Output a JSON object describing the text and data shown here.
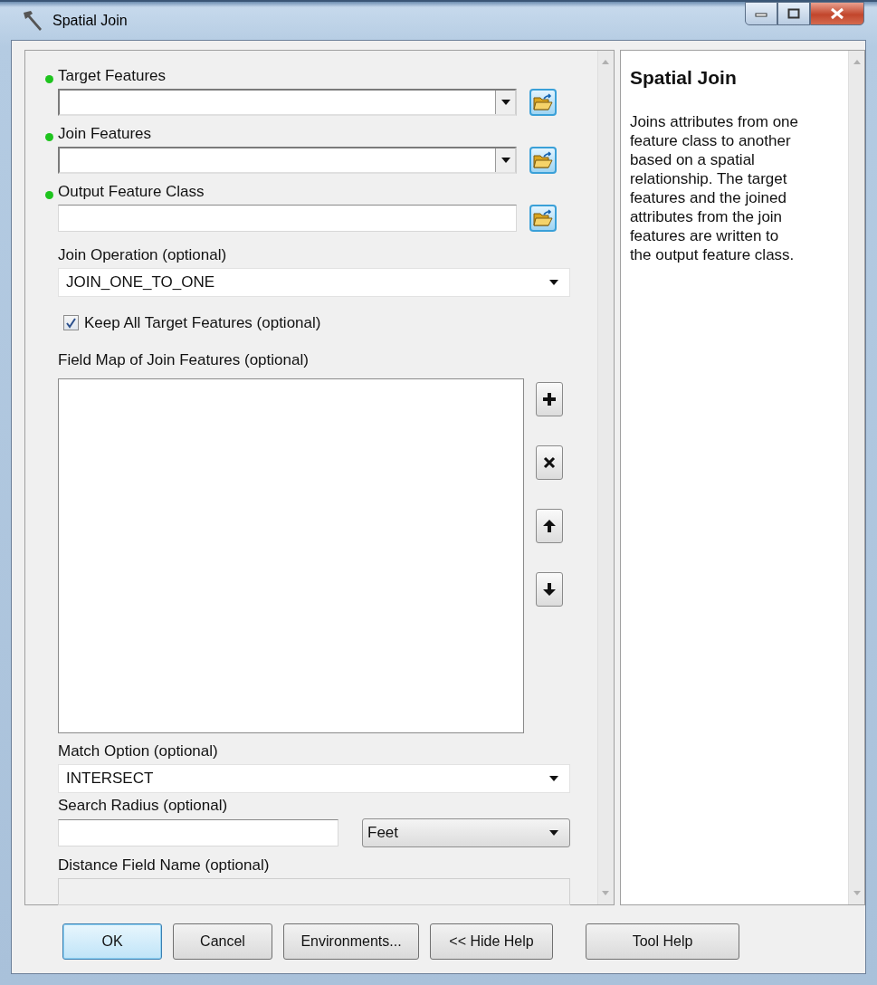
{
  "window": {
    "title": "Spatial Join"
  },
  "parameters": [
    {
      "kind": "combo",
      "label": "Target Features",
      "required": true,
      "browse": true
    },
    {
      "kind": "combo",
      "label": "Join Features",
      "required": true,
      "browse": true
    },
    {
      "kind": "text",
      "label": "Output Feature Class",
      "required": true,
      "browse": true
    },
    {
      "kind": "select",
      "label": "Join Operation (optional)",
      "value": "JOIN_ONE_TO_ONE"
    },
    {
      "kind": "checkbox",
      "label": "Keep All Target Features (optional)",
      "checked": true
    },
    {
      "kind": "fieldmap",
      "label": "Field Map of Join Features (optional)"
    },
    {
      "kind": "select",
      "label": "Match Option (optional)",
      "value": "INTERSECT"
    },
    {
      "kind": "distance",
      "label": "Search Radius (optional)",
      "unit": "Feet"
    },
    {
      "kind": "text",
      "label": "Distance Field Name (optional)",
      "disabled": true
    }
  ],
  "help": {
    "title": "Spatial Join",
    "text": "Joins attributes from one feature class to another based on a spatial relationship. The target features and the joined attributes from the join features are written to the output feature class."
  },
  "buttons": [
    {
      "label": "OK",
      "default": true
    },
    {
      "label": "Cancel",
      "default": false
    },
    {
      "label": "Environments...",
      "default": false
    },
    {
      "label": "<< Hide Help",
      "default": false
    },
    {
      "label": "Tool Help",
      "default": false
    }
  ]
}
